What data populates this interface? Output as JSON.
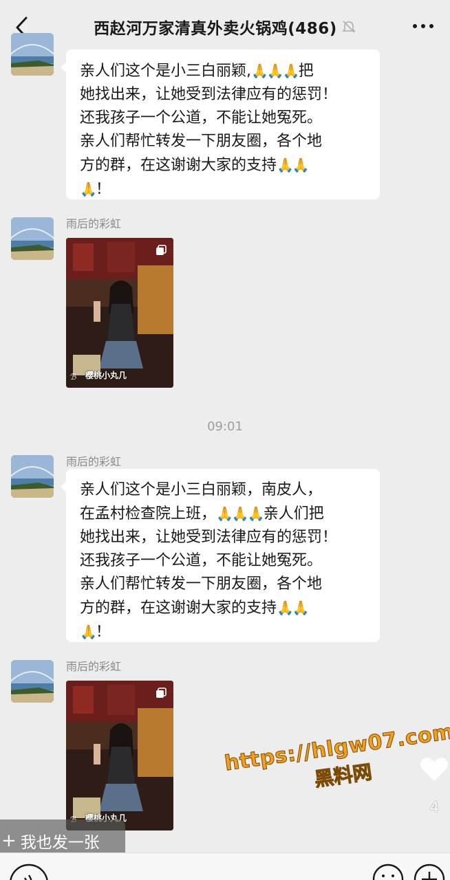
{
  "header": {
    "title": "西赵河万家清真外卖火锅鸡(486)",
    "back_icon": "chevron-left-icon",
    "mute_icon": "bell-off-icon",
    "more_icon": "more-dots-icon"
  },
  "messages": [
    {
      "type": "text",
      "sender": "",
      "lines": [
        "亲人们这个是小三白丽颖,",
        "把",
        "她找出来，让她受到法律应有的惩罚！",
        "还我孩子一个公道，不能让她冤死。",
        "亲人们帮忙转发一下朋友圈，各个地",
        "方的群，在这谢谢大家的支持",
        "！"
      ]
    },
    {
      "type": "image",
      "sender": "雨后的彩虹",
      "caption": "樱桃小丸几"
    },
    {
      "type": "text",
      "sender": "雨后的彩虹",
      "lines": [
        "亲人们这个是小三白丽颖，南皮人，",
        "在孟村检查院上班，",
        "亲人们把",
        "她找出来，让她受到法律应有的惩罚！",
        "还我孩子一个公道，不能让她冤死。",
        "亲人们帮忙转发一下朋友圈，各个地",
        "方的群，在这谢谢大家的支持",
        "！"
      ]
    },
    {
      "type": "image",
      "sender": "雨后的彩虹",
      "caption": "樱桃小丸几"
    }
  ],
  "timestamp": "09:01",
  "watermark": {
    "url": "https://hlgw07.com",
    "name": "黑料网"
  },
  "overlay": {
    "like_count": "4",
    "post_button": "我也发一张",
    "post_plus": "+"
  },
  "emoji": "🙏",
  "colors": {
    "background": "#ededed",
    "bubble": "#ffffff",
    "watermark": "#f2a01c"
  }
}
